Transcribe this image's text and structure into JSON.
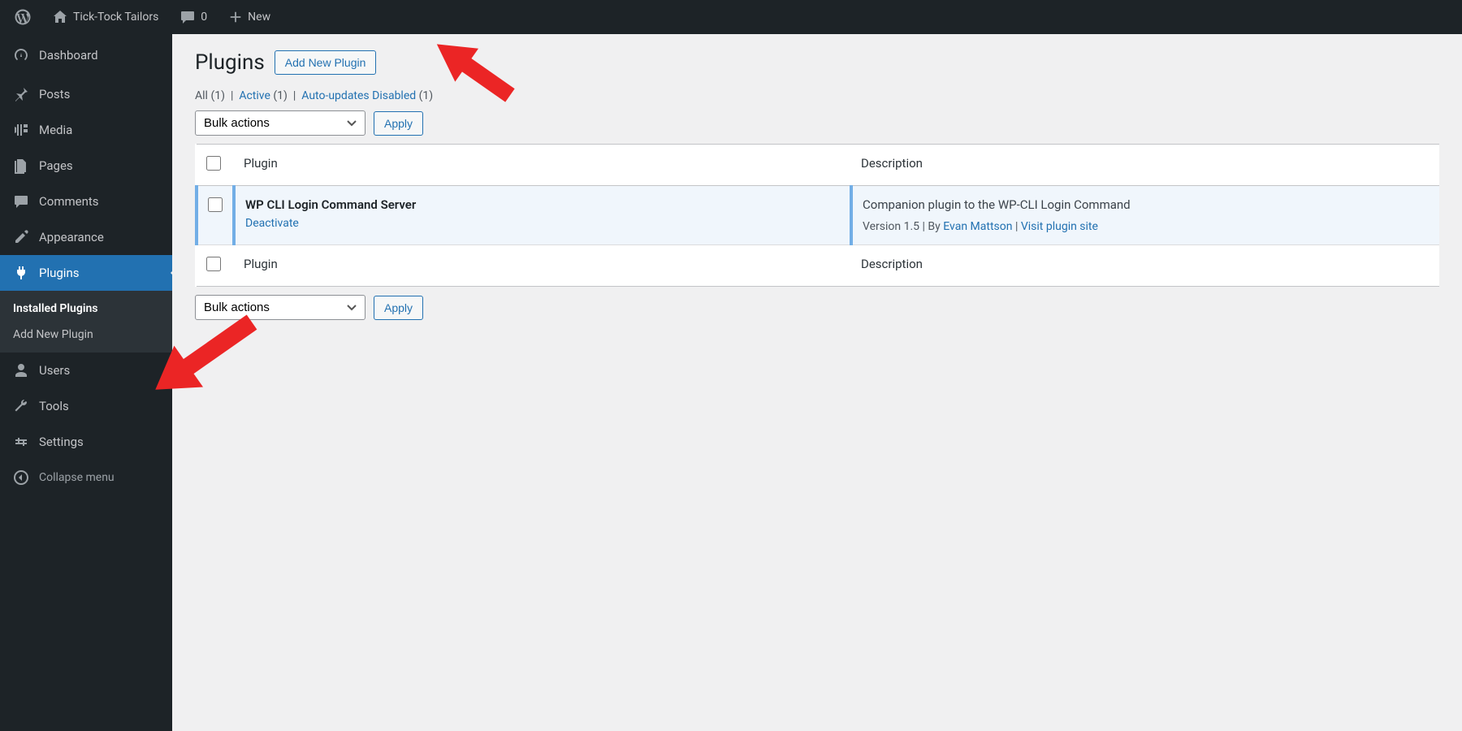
{
  "adminbar": {
    "site_name": "Tick-Tock Tailors",
    "comments_count": "0",
    "new_label": "New"
  },
  "sidebar": {
    "dashboard": "Dashboard",
    "posts": "Posts",
    "media": "Media",
    "pages": "Pages",
    "comments": "Comments",
    "appearance": "Appearance",
    "plugins": "Plugins",
    "users": "Users",
    "tools": "Tools",
    "settings": "Settings",
    "collapse": "Collapse menu",
    "submenu": {
      "installed": "Installed Plugins",
      "add_new": "Add New Plugin"
    }
  },
  "page": {
    "title": "Plugins",
    "add_button": "Add New Plugin",
    "filters": {
      "all_label": "All",
      "all_count": "(1)",
      "sep": "|",
      "active_label": "Active",
      "active_count": "(1)",
      "autoupdate_label": "Auto-updates Disabled",
      "autoupdate_count": "(1)"
    },
    "bulk_actions_label": "Bulk actions",
    "apply_label": "Apply",
    "columns": {
      "plugin": "Plugin",
      "description": "Description"
    },
    "plugins": [
      {
        "name": "WP CLI Login Command Server",
        "action": "Deactivate",
        "description": "Companion plugin to the WP-CLI Login Command",
        "meta_version": "Version 1.5",
        "meta_by": "By",
        "meta_author": "Evan Mattson",
        "meta_visit": "Visit plugin site"
      }
    ]
  }
}
